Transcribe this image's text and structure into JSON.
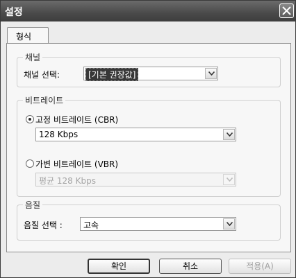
{
  "window": {
    "title": "설정"
  },
  "tabs": [
    {
      "label": "형식"
    }
  ],
  "channel": {
    "legend": "채널",
    "label": "채널 선택:",
    "value": "[기본 권장값]"
  },
  "bitrate": {
    "legend": "비트레이트",
    "cbr": {
      "label": "고정 비트레이트 (CBR)",
      "checked": true,
      "value": "128 Kbps"
    },
    "vbr": {
      "label": "가변 비트레이트 (VBR)",
      "checked": false,
      "value": "평균 128 Kbps"
    }
  },
  "quality": {
    "legend": "음질",
    "label": "음질 선택 :",
    "value": "고속"
  },
  "buttons": {
    "ok": "확인",
    "cancel": "취소",
    "apply": "적용(A)"
  },
  "icons": {
    "close": "close-icon",
    "dropdown": "chevron-down-icon"
  }
}
